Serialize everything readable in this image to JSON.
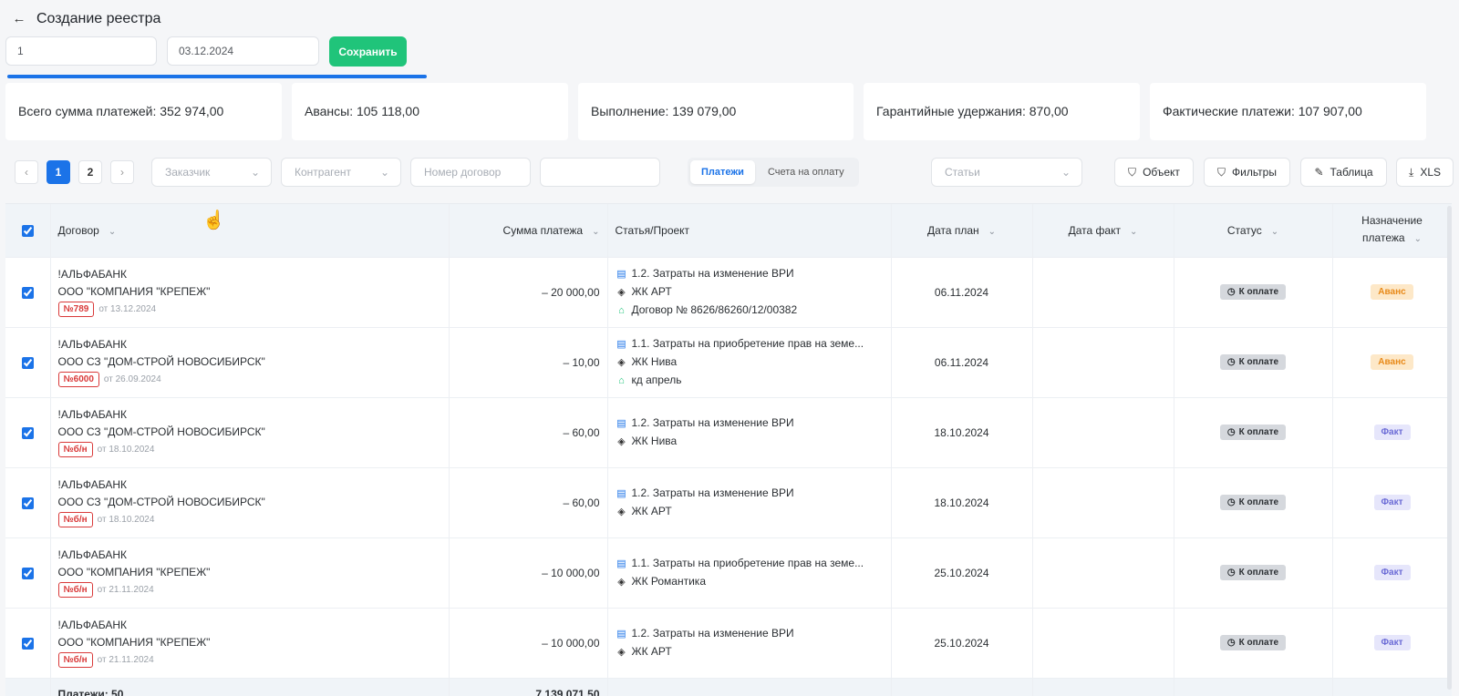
{
  "header": {
    "back_icon": "arrow-left-icon",
    "title": "Создание реестра",
    "number_value": "1",
    "date_value": "03.12.2024",
    "save_label": "Сохранить"
  },
  "summary": {
    "total": "Всего сумма платежей: 352 974,00",
    "advances": "Авансы: 105 118,00",
    "completion": "Выполнение: 139 079,00",
    "guarantee": "Гарантийные удержания: 870,00",
    "actual": "Фактические платежи: 107 907,00"
  },
  "progress_fraction": 1.0,
  "colors": {
    "accent": "#1b73e8",
    "save": "#20c47a",
    "tag_red": "#d93a3a",
    "advance_badge": "#fde8c8",
    "fact_badge": "#e6e6fb"
  },
  "toolbar": {
    "pages": [
      "1",
      "2"
    ],
    "prev_icon": "chevron-left-icon",
    "next_icon": "chevron-right-icon",
    "customer_placeholder": "Заказчик",
    "counterparty_placeholder": "Контрагент",
    "contract_number_placeholder": "Номер договор",
    "extra_input_value": "",
    "tabs": [
      "Платежи",
      "Счета на оплату"
    ],
    "articles_placeholder": "Статьи",
    "object_label": "Объект",
    "filters_label": "Фильтры",
    "table_label": "Таблица",
    "xls_label": "XLS"
  },
  "table": {
    "columns": {
      "contract": "Договор",
      "amount": "Сумма платежа",
      "article": "Статья/Проект",
      "date_plan": "Дата план",
      "date_fact": "Дата факт",
      "status": "Статус",
      "purpose_1": "Назначение",
      "purpose_2": "платежа"
    },
    "rows": [
      {
        "bank": "!АЛЬФАБАНК",
        "org": "ООО \"КОМПАНИЯ \"КРЕПЕЖ\"",
        "contract_no": "№789",
        "contract_date": "от 13.12.2024",
        "amount": "– 20 000,00",
        "article": "1.2. Затраты на изменение ВРИ",
        "project": "ЖК АРТ",
        "extra": "Договор № 8626/86260/12/00382",
        "date_plan": "06.11.2024",
        "date_fact": "",
        "status": "К оплате",
        "purpose": "Аванс"
      },
      {
        "bank": "!АЛЬФАБАНК",
        "org": "ООО СЗ \"ДОМ-СТРОЙ НОВОСИБИРСК\"",
        "contract_no": "№6000",
        "contract_date": "от 26.09.2024",
        "amount": "– 10,00",
        "article": "1.1. Затраты на приобретение прав на земе...",
        "project": "ЖК Нива",
        "extra": "кд апрель",
        "date_plan": "06.11.2024",
        "date_fact": "",
        "status": "К оплате",
        "purpose": "Аванс"
      },
      {
        "bank": "!АЛЬФАБАНК",
        "org": "ООО СЗ \"ДОМ-СТРОЙ НОВОСИБИРСК\"",
        "contract_no": "№б/н",
        "contract_date": "от 18.10.2024",
        "amount": "– 60,00",
        "article": "1.2. Затраты на изменение ВРИ",
        "project": "ЖК Нива",
        "extra": "",
        "date_plan": "18.10.2024",
        "date_fact": "",
        "status": "К оплате",
        "purpose": "Факт"
      },
      {
        "bank": "!АЛЬФАБАНК",
        "org": "ООО СЗ \"ДОМ-СТРОЙ НОВОСИБИРСК\"",
        "contract_no": "№б/н",
        "contract_date": "от 18.10.2024",
        "amount": "– 60,00",
        "article": "1.2. Затраты на изменение ВРИ",
        "project": "ЖК АРТ",
        "extra": "",
        "date_plan": "18.10.2024",
        "date_fact": "",
        "status": "К оплате",
        "purpose": "Факт"
      },
      {
        "bank": "!АЛЬФАБАНК",
        "org": "ООО \"КОМПАНИЯ \"КРЕПЕЖ\"",
        "contract_no": "№б/н",
        "contract_date": "от 21.11.2024",
        "amount": "– 10 000,00",
        "article": "1.1. Затраты на приобретение прав на земе...",
        "project": "ЖК Романтика",
        "extra": "",
        "date_plan": "25.10.2024",
        "date_fact": "",
        "status": "К оплате",
        "purpose": "Факт"
      },
      {
        "bank": "!АЛЬФАБАНК",
        "org": "ООО \"КОМПАНИЯ \"КРЕПЕЖ\"",
        "contract_no": "№б/н",
        "contract_date": "от 21.11.2024",
        "amount": "– 10 000,00",
        "article": "1.2. Затраты на изменение ВРИ",
        "project": "ЖК АРТ",
        "extra": "",
        "date_plan": "25.10.2024",
        "date_fact": "",
        "status": "К оплате",
        "purpose": "Факт"
      }
    ],
    "footer": {
      "count": "Платежи: 50",
      "total": "7 139 071,50"
    }
  }
}
